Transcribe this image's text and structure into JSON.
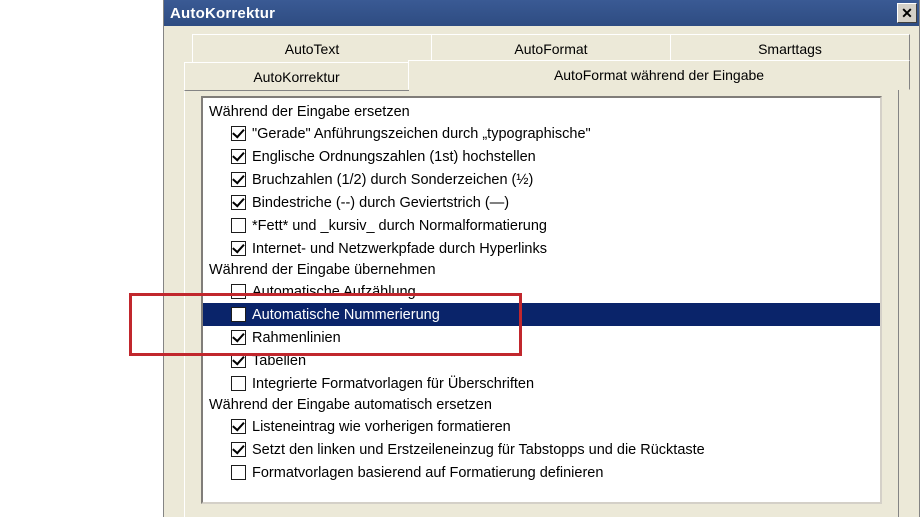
{
  "dialog": {
    "title": "AutoKorrektur"
  },
  "tabs": {
    "row1": [
      {
        "id": "autotext",
        "label": "AutoText"
      },
      {
        "id": "autoformat",
        "label": "AutoFormat"
      },
      {
        "id": "smarttags",
        "label": "Smarttags"
      }
    ],
    "row2": [
      {
        "id": "autokorrektur",
        "label": "AutoKorrektur"
      },
      {
        "id": "autoformat-waehrend",
        "label": "AutoFormat während der Eingabe",
        "active": true
      }
    ]
  },
  "sections": [
    {
      "title": "Während der Eingabe ersetzen",
      "items": [
        {
          "label": "\"Gerade\" Anführungszeichen durch „typographische\"",
          "checked": true
        },
        {
          "label": "Englische Ordnungszahlen (1st) hochstellen",
          "checked": true
        },
        {
          "label": "Bruchzahlen (1/2) durch Sonderzeichen (½)",
          "checked": true
        },
        {
          "label": "Bindestriche (--) durch Geviertstrich (—)",
          "checked": true
        },
        {
          "label": "*Fett* und _kursiv_ durch Normalformatierung",
          "checked": false
        },
        {
          "label": "Internet- und Netzwerkpfade durch Hyperlinks",
          "checked": true
        }
      ]
    },
    {
      "title": "Während der Eingabe übernehmen",
      "items": [
        {
          "label": "Automatische Aufzählung",
          "checked": false
        },
        {
          "label": "Automatische Nummerierung",
          "checked": false,
          "selected": true
        },
        {
          "label": "Rahmenlinien",
          "checked": true
        },
        {
          "label": "Tabellen",
          "checked": true
        },
        {
          "label": "Integrierte Formatvorlagen für Überschriften",
          "checked": false
        }
      ]
    },
    {
      "title": "Während der Eingabe automatisch ersetzen",
      "items": [
        {
          "label": "Listeneintrag wie vorherigen formatieren",
          "checked": true
        },
        {
          "label": "Setzt den linken und Erstzeileneinzug für Tabstopps und die Rücktaste",
          "checked": true
        },
        {
          "label": "Formatvorlagen basierend auf Formatierung definieren",
          "checked": false
        }
      ]
    }
  ],
  "highlight": {
    "note": "red annotation box around 'Automatische Aufzählung' and 'Automatische Nummerierung'"
  }
}
